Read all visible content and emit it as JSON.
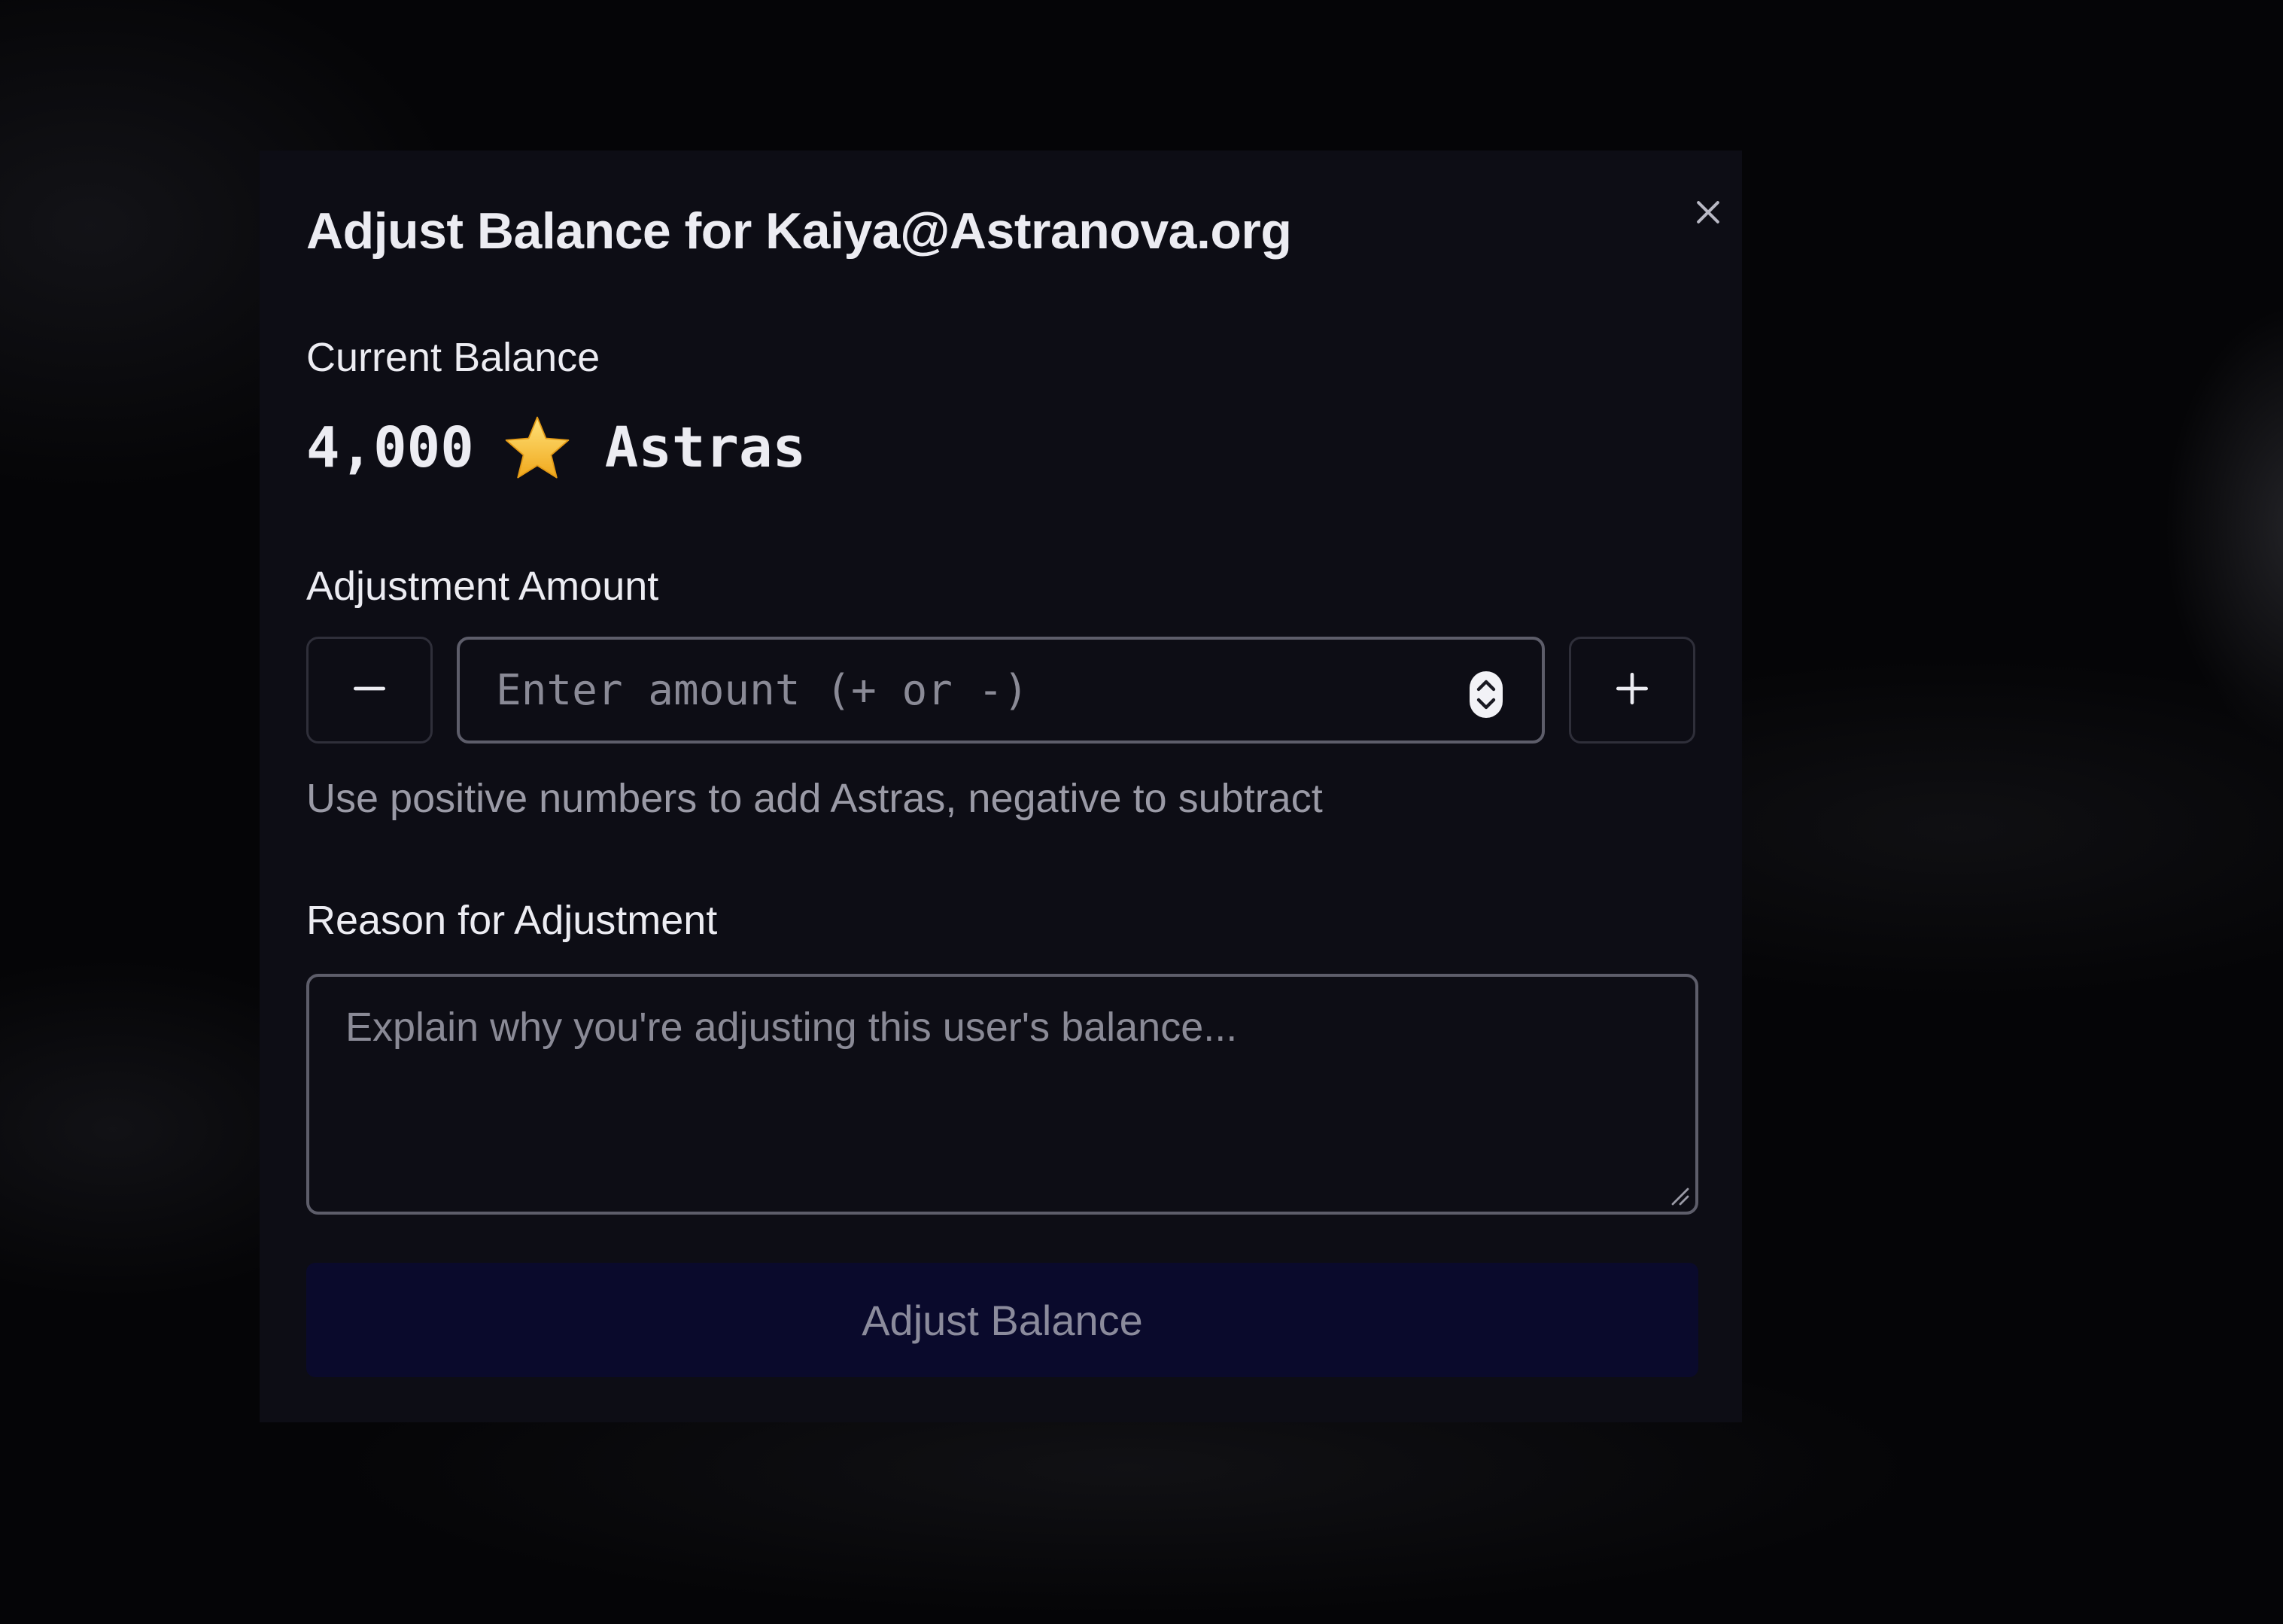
{
  "modal": {
    "title": "Adjust Balance for Kaiya@Astranova.org",
    "close_icon": "close-icon"
  },
  "balance": {
    "label": "Current Balance",
    "amount": "4,000",
    "icon": "star-icon",
    "unit": "Astras"
  },
  "adjustment": {
    "label": "Adjustment Amount",
    "decrement_icon": "minus-icon",
    "increment_icon": "plus-icon",
    "placeholder": "Enter amount (+ or -)",
    "value": "",
    "hint": "Use positive numbers to add Astras, negative to subtract"
  },
  "reason": {
    "label": "Reason for Adjustment",
    "placeholder": "Explain why you're adjusting this user's balance...",
    "value": ""
  },
  "submit": {
    "label": "Adjust Balance"
  },
  "colors": {
    "modal_background": "#0d0d15",
    "page_background": "#050507",
    "text_primary": "#ececf2",
    "text_muted": "#9a9aa6",
    "input_border": "#5d5d6a",
    "button_background": "#0a0a2c",
    "star": "#f5c22e"
  }
}
